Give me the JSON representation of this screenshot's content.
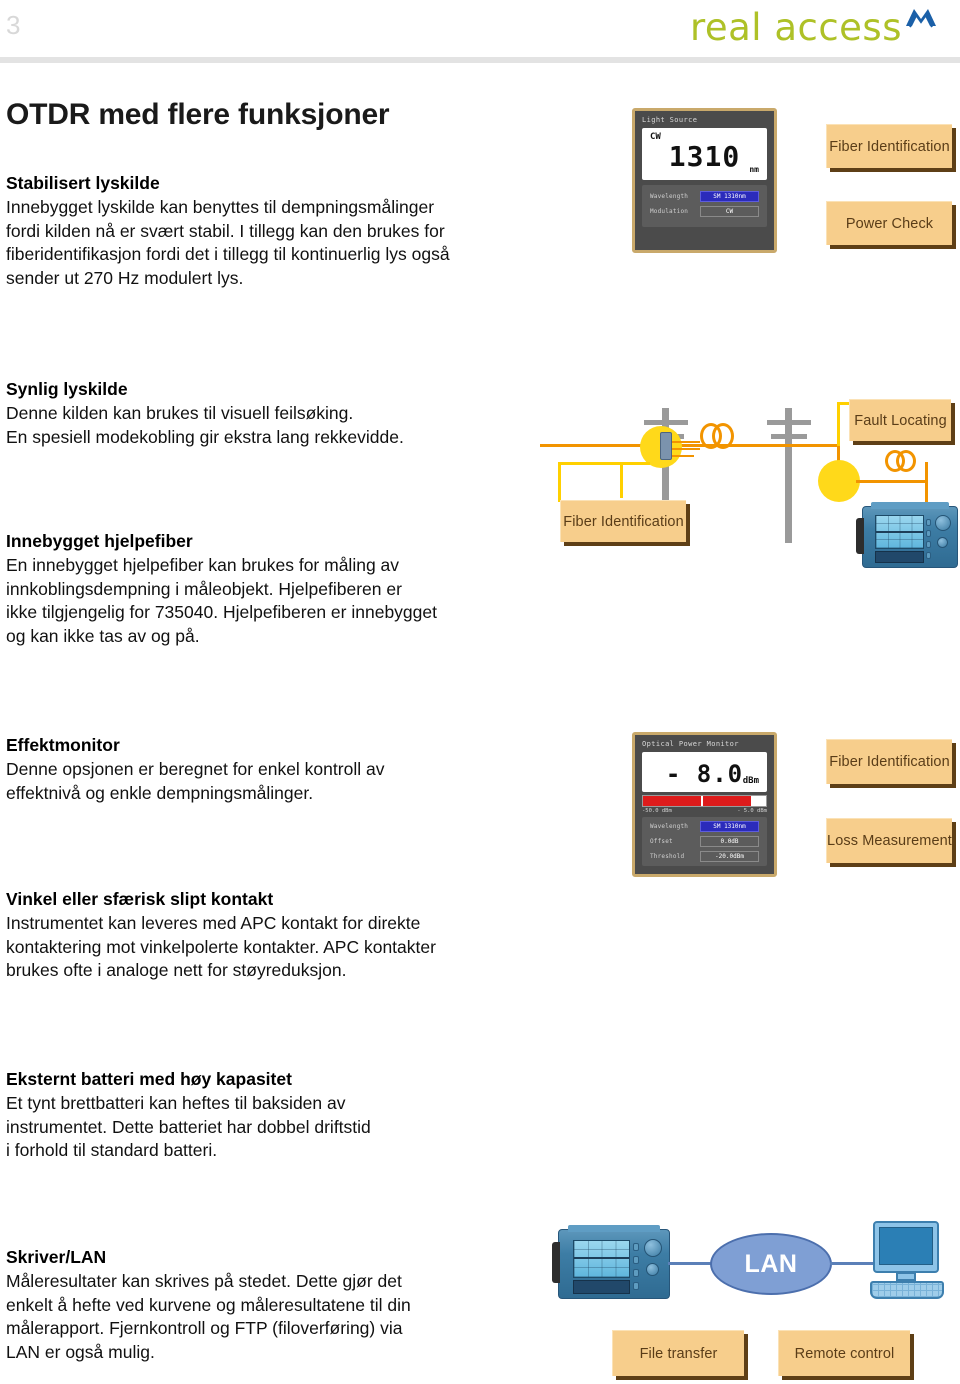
{
  "header": {
    "page_number": "3",
    "logo_text": "real access",
    "logo_mark_name": "mountain-m-logo"
  },
  "main_title": "OTDR med flere funksjoner",
  "sections": [
    {
      "id": "stabilisert",
      "heading": "Stabilisert lyskilde",
      "lines": [
        "Innebygget lyskilde kan benyttes til dempningsmålinger",
        "fordi kilden nå er svært stabil. I tillegg kan den brukes for",
        "fiberidentifikasjon fordi det i tillegg til kontinuerlig lys også",
        "sender ut 270 Hz modulert lys."
      ]
    },
    {
      "id": "synlig",
      "heading": "Synlig lyskilde",
      "lines": [
        "Denne kilden kan brukes til visuell feilsøking.",
        "En spesiell modekobling gir ekstra lang rekkevidde."
      ]
    },
    {
      "id": "hjelpefiber",
      "heading": "Innebygget hjelpefiber",
      "lines": [
        "En innebygget hjelpefiber kan brukes for måling av",
        "innkoblingsdempning i måleobjekt. Hjelpefiberen er",
        "ikke tilgjengelig for 735040. Hjelpefiberen er innebygget",
        "og kan ikke tas av og på."
      ]
    },
    {
      "id": "effekt",
      "heading": "Effektmonitor",
      "lines": [
        "Denne opsjonen er beregnet for enkel kontroll av",
        "effektnivå og enkle dempningsmålinger."
      ]
    },
    {
      "id": "vinkel",
      "heading": "Vinkel eller sfærisk slipt kontakt",
      "lines": [
        "Instrumentet kan leveres med APC kontakt for direkte",
        "kontaktering mot vinkelpolerte kontakter. APC kontakter",
        "brukes ofte i analoge nett for støyreduksjon."
      ]
    },
    {
      "id": "batteri",
      "heading": "Eksternt batteri med høy kapasitet",
      "lines": [
        "Et tynt brettbatteri kan heftes til baksiden av",
        "instrumentet. Dette batteriet har dobbel driftstid",
        "i forhold til standard batteri."
      ]
    },
    {
      "id": "skriver",
      "heading": "Skriver/LAN",
      "lines": [
        "Måleresultater kan skrives på stedet. Dette gjør det",
        "enkelt å hefte ved kurvene og måleresultatene til din",
        "målerapport. Fjernkontroll og FTP (filoverføring) via",
        "LAN er også mulig."
      ]
    }
  ],
  "badges": {
    "fiber_identification_1": "Fiber Identification",
    "power_check": "Power Check",
    "fault_locating": "Fault Locating",
    "fiber_identification_2": "Fiber Identification",
    "fiber_identification_3": "Fiber Identification",
    "loss_measurement": "Loss Measurement",
    "file_transfer": "File transfer",
    "remote_control": "Remote control"
  },
  "light_source_panel": {
    "title": "Light Source",
    "mode": "CW",
    "value": "1310",
    "unit": "nm",
    "fields": [
      {
        "label": "Wavelength",
        "value": "SM 1310nm",
        "highlighted": true
      },
      {
        "label": "Modulation",
        "value": "CW",
        "highlighted": false
      }
    ]
  },
  "power_monitor_panel": {
    "title": "Optical Power Monitor",
    "value": "- 8.0",
    "unit": "dBm",
    "scale_min": "-50.0 dBm",
    "scale_max": "- 5.0 dBm",
    "bar_fill_percent": 88,
    "fields": [
      {
        "label": "Wavelength",
        "value": "SM 1310nm",
        "highlighted": true
      },
      {
        "label": "Offset",
        "value": "0.0dB",
        "highlighted": false
      },
      {
        "label": "Threshold",
        "value": "-20.0dBm",
        "highlighted": false
      }
    ]
  },
  "lan_diagram": {
    "cloud_label": "LAN"
  },
  "colors": {
    "logo_green": "#aec127",
    "logo_blue": "#1b60a8",
    "badge_fill": "#f7ce8c",
    "badge_shadow": "#5e3f16",
    "badge_text": "#5a3d18",
    "cable_orange": "#f29400",
    "glow_yellow": "#ffd91a",
    "lan_blue": "#7f9fd4",
    "rule_gray": "#e3e3e3"
  }
}
